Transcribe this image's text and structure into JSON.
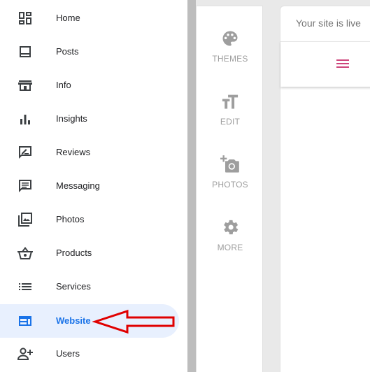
{
  "sidebar": {
    "items": [
      {
        "label": "Home",
        "icon": "dashboard-icon"
      },
      {
        "label": "Posts",
        "icon": "posts-icon"
      },
      {
        "label": "Info",
        "icon": "storefront-icon"
      },
      {
        "label": "Insights",
        "icon": "bar-chart-icon"
      },
      {
        "label": "Reviews",
        "icon": "rate-review-icon"
      },
      {
        "label": "Messaging",
        "icon": "message-icon"
      },
      {
        "label": "Photos",
        "icon": "photo-library-icon"
      },
      {
        "label": "Products",
        "icon": "basket-icon"
      },
      {
        "label": "Services",
        "icon": "list-icon"
      },
      {
        "label": "Website",
        "icon": "web-icon",
        "active": true
      },
      {
        "label": "Users",
        "icon": "add-user-icon"
      }
    ]
  },
  "tools": [
    {
      "label": "THEMES",
      "icon": "palette-icon"
    },
    {
      "label": "EDIT",
      "icon": "text-format-icon"
    },
    {
      "label": "PHOTOS",
      "icon": "add-photo-icon"
    },
    {
      "label": "MORE",
      "icon": "gear-icon"
    }
  ],
  "preview": {
    "status": "Your site is live"
  },
  "colors": {
    "active_bg": "#e8f0fe",
    "active_text": "#1a73e8",
    "annotation": "#e00000",
    "menu_accent": "#c2185b"
  }
}
